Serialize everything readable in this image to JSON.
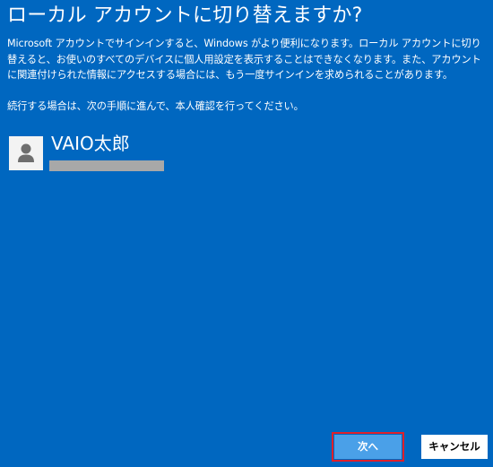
{
  "dialog": {
    "title": "ローカル アカウントに切り替えますか?",
    "paragraph1": "Microsoft アカウントでサインインすると、Windows がより便利になります。ローカル アカウントに切り替えると、お使いのすべてのデバイスに個人用設定を表示することはできなくなります。また、アカウントに関連付けられた情報にアクセスする場合には、もう一度サインインを求められることがあります。",
    "paragraph2": "続行する場合は、次の手順に進んで、本人確認を行ってください。"
  },
  "account": {
    "name": "VAIO太郎",
    "avatar_icon": "user-avatar-icon"
  },
  "buttons": {
    "next_label": "次へ",
    "cancel_label": "キャンセル"
  },
  "colors": {
    "background": "#0067c0",
    "next_button": "#4aa0e8",
    "highlight_outline": "#e0202a",
    "redaction_bar": "#a8a8a8"
  }
}
